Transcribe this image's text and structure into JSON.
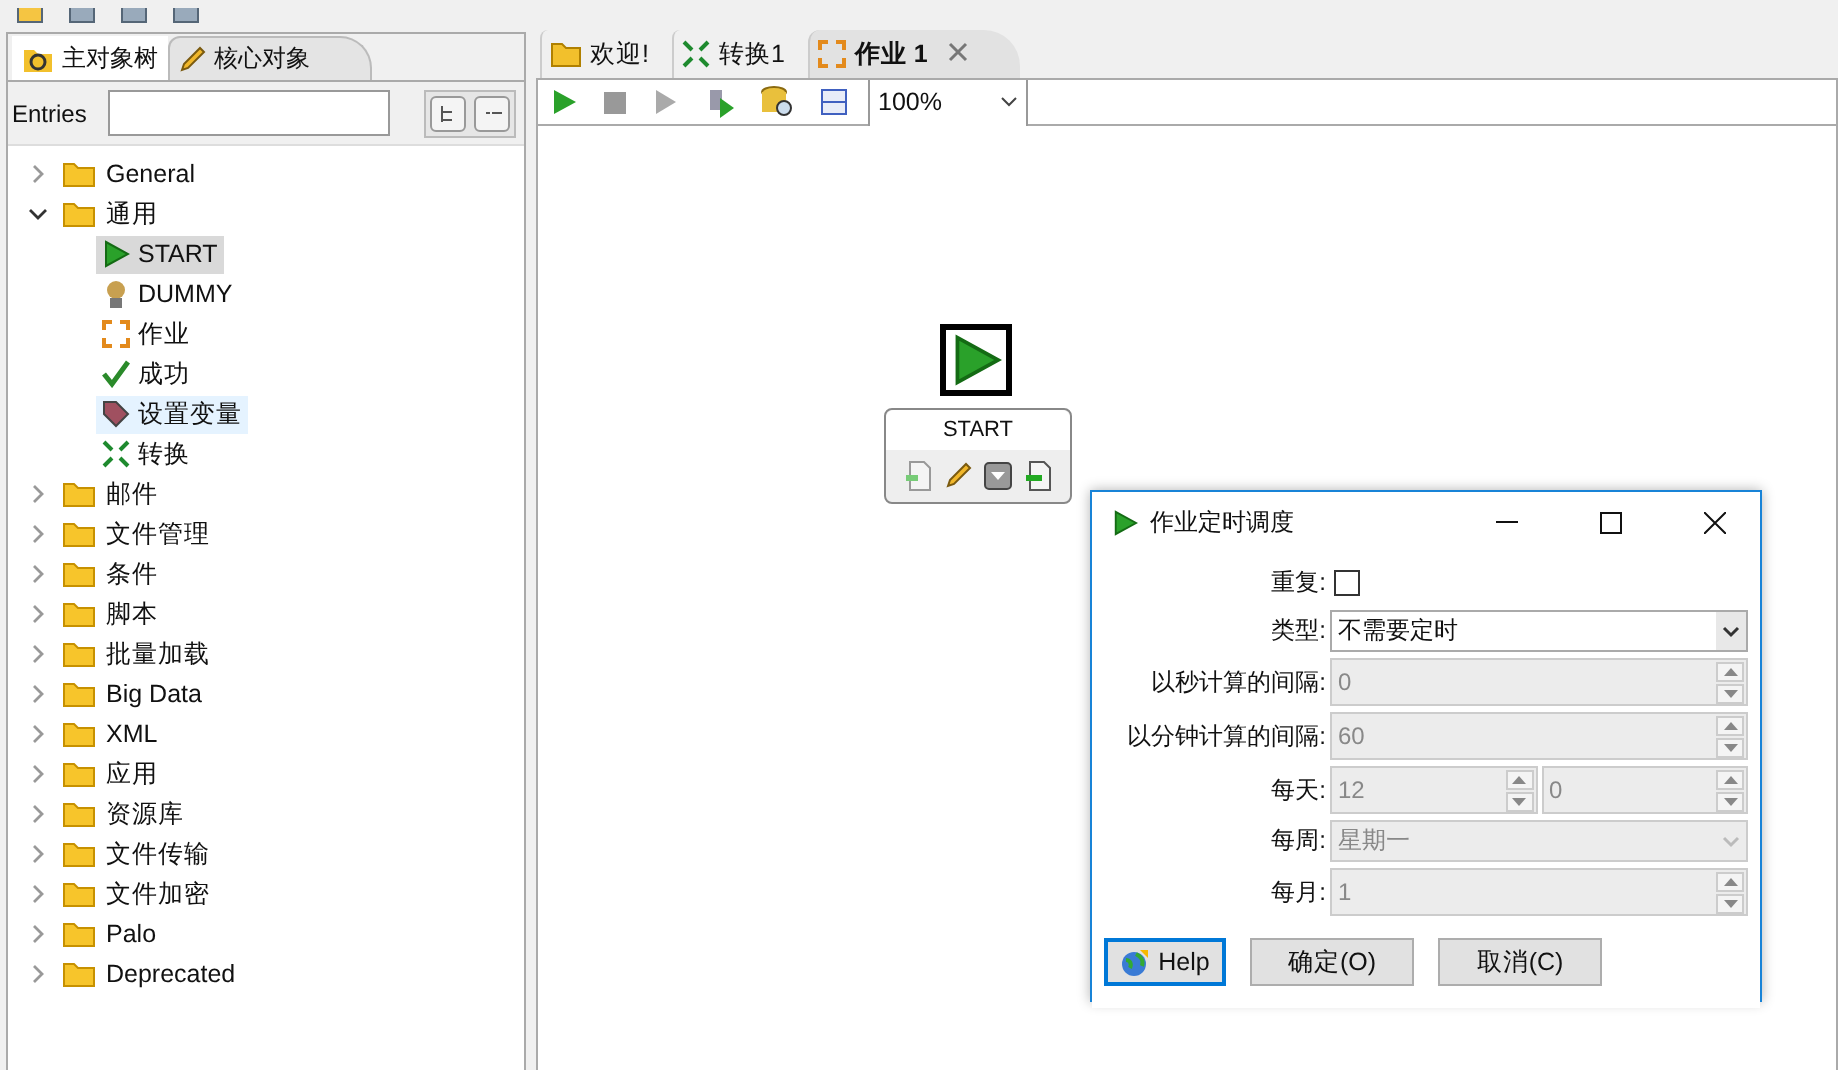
{
  "left_panel": {
    "tabs": [
      {
        "label": "主对象树",
        "selected": false
      },
      {
        "label": "核心对象",
        "selected": true
      }
    ],
    "filter": {
      "label": "Entries"
    },
    "tree": [
      {
        "label": "General",
        "expanded": false
      },
      {
        "label": "通用",
        "expanded": true,
        "children": [
          {
            "label": "START",
            "kind": "start",
            "selected": true,
            "hovered": false
          },
          {
            "label": "DUMMY",
            "kind": "dummy",
            "selected": false,
            "hovered": false
          },
          {
            "label": "作业",
            "kind": "job",
            "selected": false,
            "hovered": false
          },
          {
            "label": "成功",
            "kind": "success",
            "selected": false,
            "hovered": false
          },
          {
            "label": "设置变量",
            "kind": "variable",
            "selected": false,
            "hovered": true
          },
          {
            "label": "转换",
            "kind": "transformation",
            "selected": false,
            "hovered": false
          }
        ]
      },
      {
        "label": "邮件",
        "expanded": false
      },
      {
        "label": "文件管理",
        "expanded": false
      },
      {
        "label": "条件",
        "expanded": false
      },
      {
        "label": "脚本",
        "expanded": false
      },
      {
        "label": "批量加载",
        "expanded": false
      },
      {
        "label": "Big Data",
        "expanded": false
      },
      {
        "label": "XML",
        "expanded": false
      },
      {
        "label": "应用",
        "expanded": false
      },
      {
        "label": "资源库",
        "expanded": false
      },
      {
        "label": "文件传输",
        "expanded": false
      },
      {
        "label": "文件加密",
        "expanded": false
      },
      {
        "label": "Palo",
        "expanded": false
      },
      {
        "label": "Deprecated",
        "expanded": false
      }
    ]
  },
  "editor": {
    "tabs": [
      {
        "label": "欢迎!",
        "kind": "welcome",
        "selected": false,
        "closable": false
      },
      {
        "label": "转换1",
        "kind": "transformation",
        "selected": false,
        "closable": false
      },
      {
        "label": "作业 1",
        "kind": "job",
        "selected": true,
        "closable": true
      }
    ],
    "zoom": "100%",
    "node": {
      "label": "START"
    }
  },
  "dialog": {
    "title": "作业定时调度",
    "fields": [
      {
        "kind": "checkbox",
        "label": "重复:",
        "checked": false
      },
      {
        "kind": "select",
        "label": "类型:",
        "value": "不需要定时",
        "disabled": false
      },
      {
        "kind": "spinner",
        "label": "以秒计算的间隔:",
        "values": [
          "0"
        ],
        "disabled": true
      },
      {
        "kind": "spinner",
        "label": "以分钟计算的间隔:",
        "values": [
          "60"
        ],
        "disabled": true
      },
      {
        "kind": "spinner",
        "label": "每天:",
        "values": [
          "12",
          "0"
        ],
        "disabled": true
      },
      {
        "kind": "select",
        "label": "每周:",
        "value": "星期一",
        "disabled": true
      },
      {
        "kind": "spinner",
        "label": "每月:",
        "values": [
          "1"
        ],
        "disabled": true
      }
    ],
    "buttons": [
      {
        "label": "Help",
        "kind": "help",
        "focused": true
      },
      {
        "label": "确定(O)",
        "kind": "plain",
        "focused": false
      },
      {
        "label": "取消(C)",
        "kind": "plain",
        "focused": false
      }
    ]
  }
}
